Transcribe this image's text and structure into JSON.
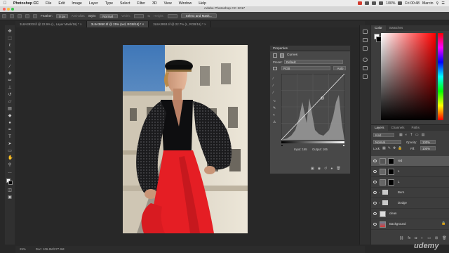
{
  "menubar": {
    "app": "Photoshop CC",
    "items": [
      "File",
      "Edit",
      "Image",
      "Layer",
      "Type",
      "Select",
      "Filter",
      "3D",
      "View",
      "Window",
      "Help"
    ],
    "battery": "100%",
    "clock": "Fri 00:48",
    "user": "Marcin"
  },
  "window_title": "Adobe Photoshop CC 2017",
  "options": {
    "feather_label": "Feather:",
    "feather_value": "0 px",
    "antialias_label": "Anti-alias",
    "style_label": "Style:",
    "style_value": "Normal",
    "width_label": "Width:",
    "height_label": "Height:",
    "select_mask": "Select and Mask..."
  },
  "tabs": [
    {
      "label": "3L8A3933.tif @ 22.9% (L, Layer Mask/16) *",
      "active": false
    },
    {
      "label": "3L8A3850.tif @ 25% (red, RGB/16) *",
      "active": true
    },
    {
      "label": "3L8A3953.tif @ 22.7% (L, RGB/16) *",
      "active": false
    }
  ],
  "properties": {
    "title": "Properties",
    "adjustment": "Curves",
    "preset_label": "Preset:",
    "preset_value": "Default",
    "channel_value": "RGB",
    "auto_label": "Auto",
    "input_label": "Input: 165",
    "output_label": "Output: 165"
  },
  "color_panel": {
    "tabs": [
      "Color",
      "Swatches"
    ],
    "accent": "#ff0000"
  },
  "layers_panel": {
    "tabs": [
      "Layers",
      "Channels",
      "Paths"
    ],
    "kind_label": "Kind",
    "blend_mode": "Normal",
    "opacity_label": "Opacity:",
    "opacity_value": "100%",
    "lock_label": "Lock:",
    "fill_label": "Fill:",
    "fill_value": "100%",
    "layers": [
      {
        "name": "red",
        "selected": true
      },
      {
        "name": "L",
        "selected": false
      },
      {
        "name": "L",
        "selected": false
      },
      {
        "name": "Burn",
        "selected": false
      },
      {
        "name": "Dodge",
        "selected": false
      },
      {
        "name": "clean",
        "selected": false
      },
      {
        "name": "Background",
        "selected": false
      }
    ]
  },
  "status": {
    "zoom": "25%",
    "doc": "Doc: 106.6M/277.9M"
  },
  "watermark": "udemy",
  "icons": [
    "apple-icon",
    "move-icon",
    "marquee-icon",
    "lasso-icon",
    "quick-select-icon",
    "crop-icon",
    "eyedropper-icon",
    "healing-icon",
    "brush-icon",
    "stamp-icon",
    "history-brush-icon",
    "eraser-icon",
    "gradient-icon",
    "blur-icon",
    "dodge-icon",
    "pen-icon",
    "type-icon",
    "path-select-icon",
    "shape-icon",
    "hand-icon",
    "zoom-icon",
    "eye-icon",
    "lock-icon",
    "search-icon",
    "menu-icon"
  ]
}
